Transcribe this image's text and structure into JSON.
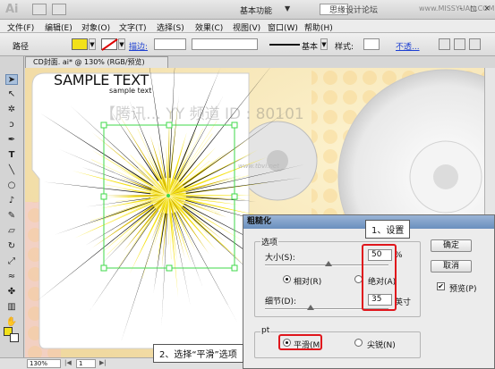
{
  "titlebar": {
    "logo": "Ai",
    "workspace": "基本功能",
    "site_mark": "思缘设计论坛",
    "site_url": "www.MISSYUAN.COM"
  },
  "menu": [
    "文件(F)",
    "编辑(E)",
    "对象(O)",
    "文字(T)",
    "选择(S)",
    "效果(C)",
    "视图(V)",
    "窗口(W)",
    "帮助(H)"
  ],
  "control_bar": {
    "path_label": "路径",
    "stroke_label": "描边:",
    "stroke_style": "基本",
    "style_label": "样式:",
    "opacity_label": "不透...",
    "fill_color": "#f2e11a"
  },
  "document": {
    "tab_title": "CD封面. ai* @ 130% (RGB/预览)",
    "sample_title": "SAMPLE TEXT",
    "sample_subtitle": "sample text",
    "watermark": "【腾讯…  YY 频道 ID : 80101",
    "site_label": "www.tbvi.net"
  },
  "status_bar": {
    "zoom": "130%",
    "page": "1"
  },
  "dialog": {
    "title": "粗糙化",
    "options_group": "选项",
    "size_label": "大小(S):",
    "size_value": "50",
    "size_unit": "%",
    "relative_label": "相对(R)",
    "absolute_label": "绝对(A)",
    "detail_label": "细节(D):",
    "detail_value": "35",
    "detail_unit": "英寸",
    "point_group": "pt",
    "smooth_label": "平滑(M)",
    "corner_label": "尖锐(N)",
    "ok_label": "确定",
    "cancel_label": "取消",
    "preview_label": "预览(P)",
    "relative_selected": true,
    "smooth_selected": true,
    "preview_checked": true
  },
  "annotations": {
    "step1": "1、设置",
    "step2": "2、选择“平滑”选项"
  }
}
